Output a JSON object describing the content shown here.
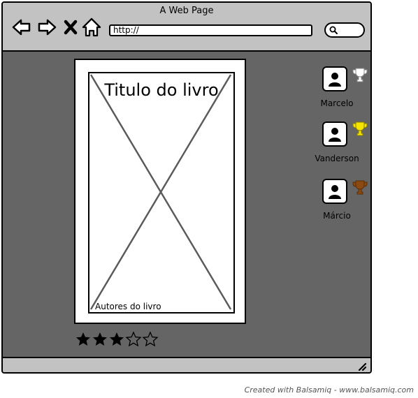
{
  "window": {
    "title": "A Web Page"
  },
  "toolbar": {
    "back_icon": "back-arrow-icon",
    "forward_icon": "forward-arrow-icon",
    "stop_icon": "close-icon",
    "home_icon": "home-icon",
    "url": "http://",
    "search_icon": "search-icon"
  },
  "book": {
    "title": "Titulo do livro",
    "authors": "Autores do livro",
    "image": "image-placeholder",
    "rating": {
      "value": 3,
      "max": 5
    }
  },
  "users": [
    {
      "name": "Marcelo",
      "trophy_color": "#ffffff"
    },
    {
      "name": "Vanderson",
      "trophy_color": "#f5e500"
    },
    {
      "name": "Márcio",
      "trophy_color": "#8b4a12"
    }
  ],
  "footer": {
    "credit": "Created with Balsamiq - www.balsamiq.com"
  },
  "colors": {
    "canvas": "#656565",
    "chrome": "#c2c2c2"
  }
}
